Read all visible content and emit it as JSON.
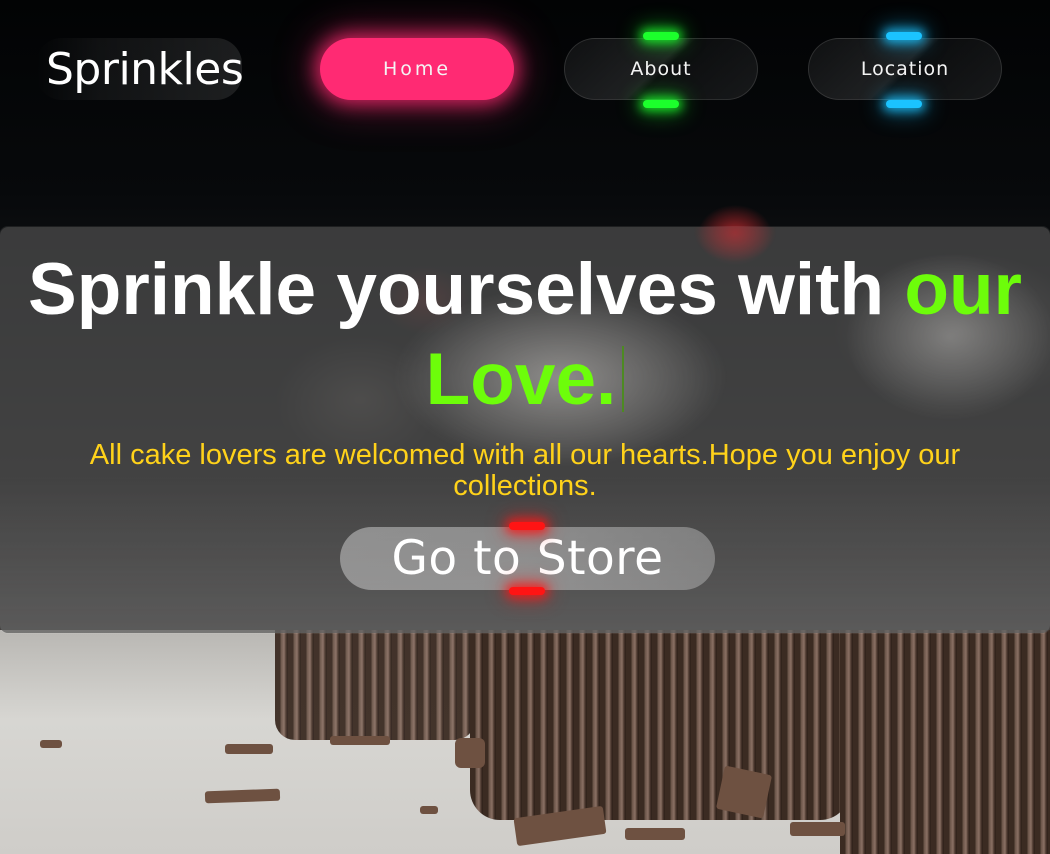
{
  "brand": {
    "name": "Sprinkles"
  },
  "nav": {
    "items": [
      {
        "label": "Home",
        "active": true
      },
      {
        "label": "About",
        "glow": "#1cff2c"
      },
      {
        "label": "Location",
        "glow": "#1bc3ff"
      }
    ]
  },
  "hero": {
    "headline_main": "Sprinkle yourselves with ",
    "headline_accent_1": "our",
    "headline_accent_2": "Love.",
    "subtitle": "All cake lovers are welcomed with all our hearts.Hope you enjoy our collections.",
    "cta_label": "Go to Store"
  },
  "colors": {
    "home_active": "#ff2a73",
    "accent_green": "#6dfd0a",
    "subtitle_yellow": "#ffd21a",
    "cta_glow_red": "#ff1414",
    "about_glow": "#1cff2c",
    "location_glow": "#1bc3ff"
  }
}
